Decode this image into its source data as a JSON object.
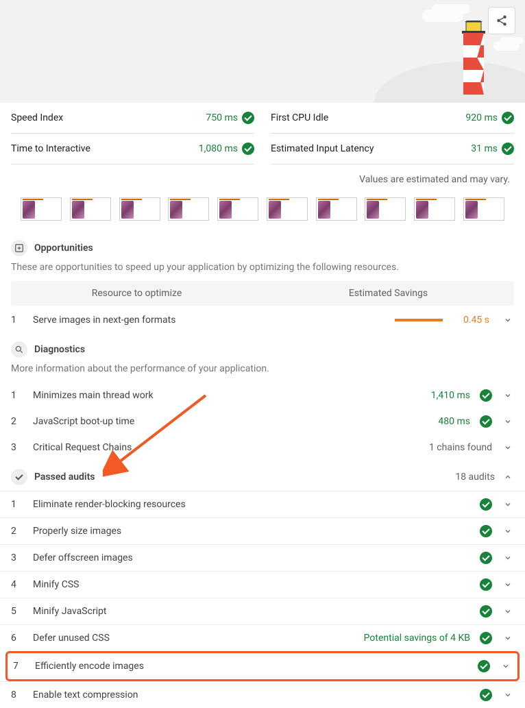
{
  "metrics": [
    {
      "label": "Speed Index",
      "value": "750 ms"
    },
    {
      "label": "First CPU Idle",
      "value": "920 ms"
    },
    {
      "label": "Time to Interactive",
      "value": "1,080 ms"
    },
    {
      "label": "Estimated Input Latency",
      "value": "31 ms"
    }
  ],
  "estimated_note": "Values are estimated and may vary.",
  "opportunities": {
    "title": "Opportunities",
    "subtitle": "These are opportunities to speed up your application by optimizing the following resources.",
    "col1": "Resource to optimize",
    "col2": "Estimated Savings",
    "items": [
      {
        "num": "1",
        "title": "Serve images in next-gen formats",
        "value": "0.45 s"
      }
    ]
  },
  "diagnostics": {
    "title": "Diagnostics",
    "subtitle": "More information about the performance of your application.",
    "items": [
      {
        "num": "1",
        "title": "Minimizes main thread work",
        "value": "1,410 ms",
        "has_dot": true
      },
      {
        "num": "2",
        "title": "JavaScript boot-up time",
        "value": "480 ms",
        "has_dot": true
      },
      {
        "num": "3",
        "title": "Critical Request Chains",
        "value": "1 chains found",
        "neutral": true
      }
    ]
  },
  "passed": {
    "title": "Passed audits",
    "count": "18 audits",
    "items": [
      {
        "num": "1",
        "title": "Eliminate render-blocking resources"
      },
      {
        "num": "2",
        "title": "Properly size images"
      },
      {
        "num": "3",
        "title": "Defer offscreen images"
      },
      {
        "num": "4",
        "title": "Minify CSS"
      },
      {
        "num": "5",
        "title": "Minify JavaScript"
      },
      {
        "num": "6",
        "title": "Defer unused CSS",
        "savings": "Potential savings of 4 KB"
      },
      {
        "num": "7",
        "title": "Efficiently encode images",
        "highlight": true
      },
      {
        "num": "8",
        "title": "Enable text compression"
      }
    ]
  }
}
